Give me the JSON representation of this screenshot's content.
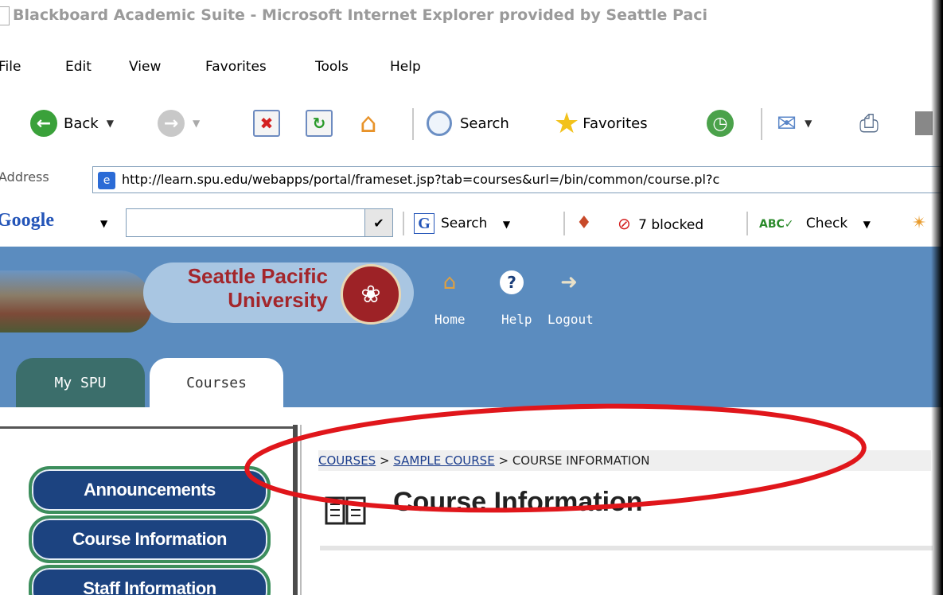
{
  "window": {
    "title": "Blackboard Academic Suite - Microsoft Internet Explorer provided by Seattle Paci"
  },
  "menu": {
    "items": [
      "File",
      "Edit",
      "View",
      "Favorites",
      "Tools",
      "Help"
    ]
  },
  "toolbar": {
    "back_label": "Back",
    "search_label": "Search",
    "favorites_label": "Favorites"
  },
  "address": {
    "label": "Address",
    "url": "http://learn.spu.edu/webapps/portal/frameset.jsp?tab=courses&url=/bin/common/course.pl?c"
  },
  "google_bar": {
    "logo": "Google",
    "search_label": "Search",
    "blocked_label": "7 blocked",
    "check_label": "Check"
  },
  "site": {
    "institution_line1": "Seattle Pacific",
    "institution_line2": "University",
    "nav": [
      "Home",
      "Help",
      "Logout"
    ],
    "tabs": [
      {
        "label": "My SPU",
        "active": false
      },
      {
        "label": "Courses",
        "active": true
      }
    ]
  },
  "course_menu": [
    "Announcements",
    "Course Information",
    "Staff Information"
  ],
  "breadcrumb": {
    "items": [
      "COURSES",
      "SAMPLE COURSE"
    ],
    "current": "COURSE INFORMATION",
    "separator": ">"
  },
  "page": {
    "title": "Course Information"
  },
  "colors": {
    "header_blue": "#5b8cbf",
    "tab_green": "#3b6e6b",
    "button_navy": "#1c4380",
    "highlight_red": "#e0161b"
  }
}
